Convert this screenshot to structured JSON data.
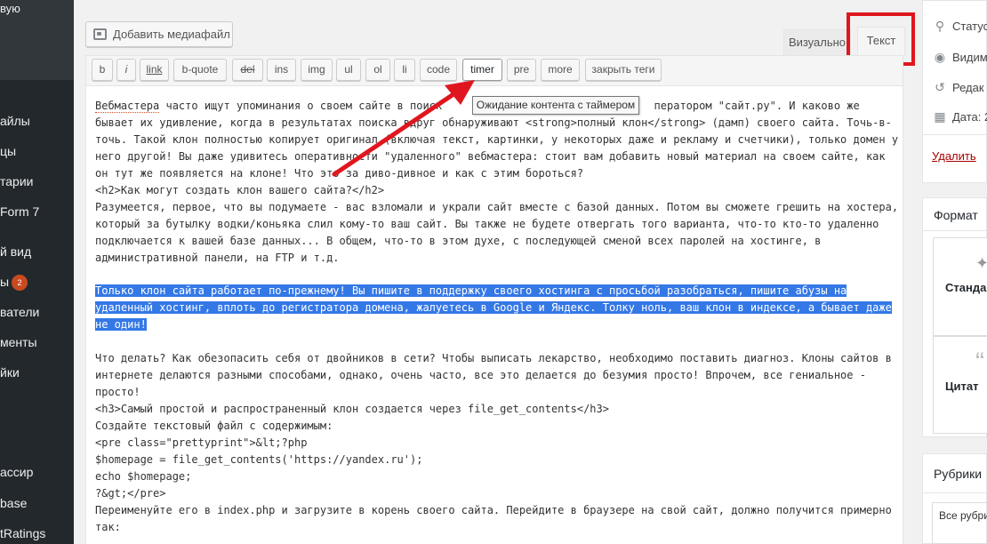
{
  "sidebar": {
    "top_text": "вую",
    "items": [
      {
        "label": "айлы"
      },
      {
        "label": "цы"
      },
      {
        "label": "тарии"
      },
      {
        "label": "Form 7"
      },
      {
        "label": "й вид"
      },
      {
        "label": "ы",
        "badge": "2"
      },
      {
        "label": "ватели"
      },
      {
        "label": "менты"
      },
      {
        "label": "йки"
      },
      {
        "label": "ассир"
      },
      {
        "label": "base"
      },
      {
        "label": "tRatings"
      }
    ]
  },
  "editor": {
    "add_media_label": "Добавить медиафайл",
    "tabs": {
      "visual": "Визуально",
      "text": "Текст"
    },
    "toolbar": [
      "b",
      "i",
      "link",
      "b-quote",
      "del",
      "ins",
      "img",
      "ul",
      "ol",
      "li",
      "code",
      "timer",
      "pre",
      "more",
      "закрыть теги"
    ],
    "tooltip": "Ожидание контента с таймером",
    "lines": {
      "l1a": "Вебмастера",
      "l1b": " часто ищут упоминания о своем сайте в поиск",
      "l1c": "                                 ператором \"сайт.ру\". И каково же",
      "l2": "бывает их удивление, когда в результатах поиска вдруг обнаруживают <strong>полный клон</strong> (дамп) своего сайта. Точь-в-",
      "l3": "точь. Такой клон полностью копирует оригинал (включая текст, картинки, у некоторых даже и рекламу и счетчики), только домен у",
      "l4": "него другой! Вы даже удивитесь оперативности \"удаленного\" вебмастера: стоит вам добавить новый материал на своем сайте, как",
      "l5": "он тут же появляется на клоне! Что это за диво-дивное и как с этим бороться?",
      "l6": "<h2>Как могут создать клон вашего сайта?</h2>",
      "l7": "Разумеется, первое, что вы подумаете - вас взломали и украли сайт вместе с базой данных. Потом вы сможете грешить на хостера,",
      "l8": "который за бутылку водки/коньяка слил кому-то ваш сайт. Вы также не будете отвергать того варианта, что-то кто-то удаленно",
      "l9": "подключается к вашей базе данных... В общем, что-то в этом духе, с последующей сменой всех паролей на хостинге, в",
      "l10": "административной панели, на FTP и т.д.",
      "s1": "Только клон сайта работает по-прежнему! Вы пишите в поддержку своего хостинга с просьбой разобраться, пишите абузы на",
      "s2": "удаленный хостинг, вплоть до регистратора домена, жалуетесь в Google и Яндекс. Толку ноль, ваш клон в индексе, а бывает даже",
      "s3": "не один!",
      "l11": "Что делать? Как обезопасить себя от двойников в сети? Чтобы выписать лекарство, необходимо поставить диагноз. Клоны сайтов в",
      "l12": "интернете делаются разными способами, однако, очень часто, все это делается до безумия просто! Впрочем, все гениальное -",
      "l13": "просто!",
      "l14": "<h3>Самый простой и распространенный клон создается через file_get_contents</h3>",
      "l15": "Создайте текстовый файл с содержимым:",
      "l16": "<pre class=\"prettyprint\">&lt;?php",
      "l17": "$homepage = file_get_contents('https://yandex.ru');",
      "l18": "echo $homepage;",
      "l19": "?&gt;</pre>",
      "l20": "Переименуйте его в index.php и загрузите в корень своего сайта. Перейдите в браузере на свой сайт, должно получится примерно",
      "l21": "так:"
    }
  },
  "publish": {
    "status": "Статус",
    "visibility": "Видим",
    "revisions": "Редак",
    "date": "Дата: 2",
    "delete": "Удалить"
  },
  "format": {
    "title": "Формат",
    "standard": "Стандар",
    "quote": "Цитат"
  },
  "categories": {
    "title": "Рубрики",
    "all": "Все рубри"
  },
  "colors": {
    "highlight": "#e0161e",
    "selection": "#3478e6",
    "sidebar": "#23282d"
  }
}
